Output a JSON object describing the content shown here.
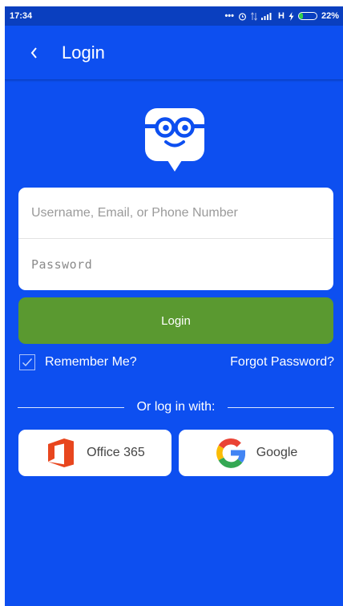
{
  "status_bar": {
    "time": "17:34",
    "icons": [
      "more-dots-icon",
      "alarm-icon",
      "data-arrows-icon",
      "signal-icon",
      "charging-icon",
      "battery-icon"
    ],
    "network": "H",
    "battery_percent": "22%",
    "battery_level": 0.22,
    "battery_color": "#35d04a"
  },
  "app_bar": {
    "back_icon": "back-chevron-icon",
    "title": "Login"
  },
  "mascot_icon": "edmodo-mascot-icon",
  "form": {
    "username_placeholder": "Username, Email, or Phone Number",
    "username_value": "",
    "password_placeholder": "Password",
    "password_value": ""
  },
  "login_button": {
    "label": "Login"
  },
  "remember_me": {
    "label": "Remember Me?",
    "checked": true
  },
  "forgot_password": {
    "label": "Forgot Password?"
  },
  "alt_login": {
    "label": "Or log in with:"
  },
  "social": {
    "office": {
      "label": "Office 365",
      "icon": "office365-icon"
    },
    "google": {
      "label": "Google",
      "icon": "google-icon"
    }
  },
  "colors": {
    "background": "#0d4ff0",
    "status_bar": "#0a3fbf",
    "login_button": "#5a9930",
    "office": "#e8461e"
  }
}
